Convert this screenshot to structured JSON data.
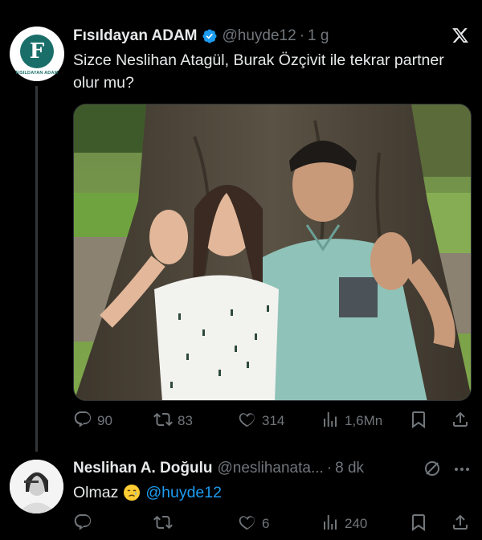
{
  "tweet": {
    "author_name": "Fısıldayan ADAM",
    "handle": "@huyde12",
    "time": "1 g",
    "avatar_text": "FISILDAYAN ADAM",
    "avatar_letter": "F",
    "text": "Sizce Neslihan Atagül, Burak Özçivit ile tekrar partner olur mu?",
    "stats": {
      "replies": "90",
      "retweets": "83",
      "likes": "314",
      "views": "1,6Mn"
    }
  },
  "reply": {
    "author_name": "Neslihan A. Doğulu",
    "handle": "@neslihanata...",
    "time": "8 dk",
    "text": "Olmaz",
    "mention": "@huyde12",
    "stats": {
      "replies": "",
      "retweets": "",
      "likes": "6",
      "views": "240"
    }
  },
  "colors": {
    "background": "#000000",
    "text": "#e7e9ea",
    "secondary": "#71767b",
    "accent": "#1d9bf0",
    "divider": "#333639"
  }
}
